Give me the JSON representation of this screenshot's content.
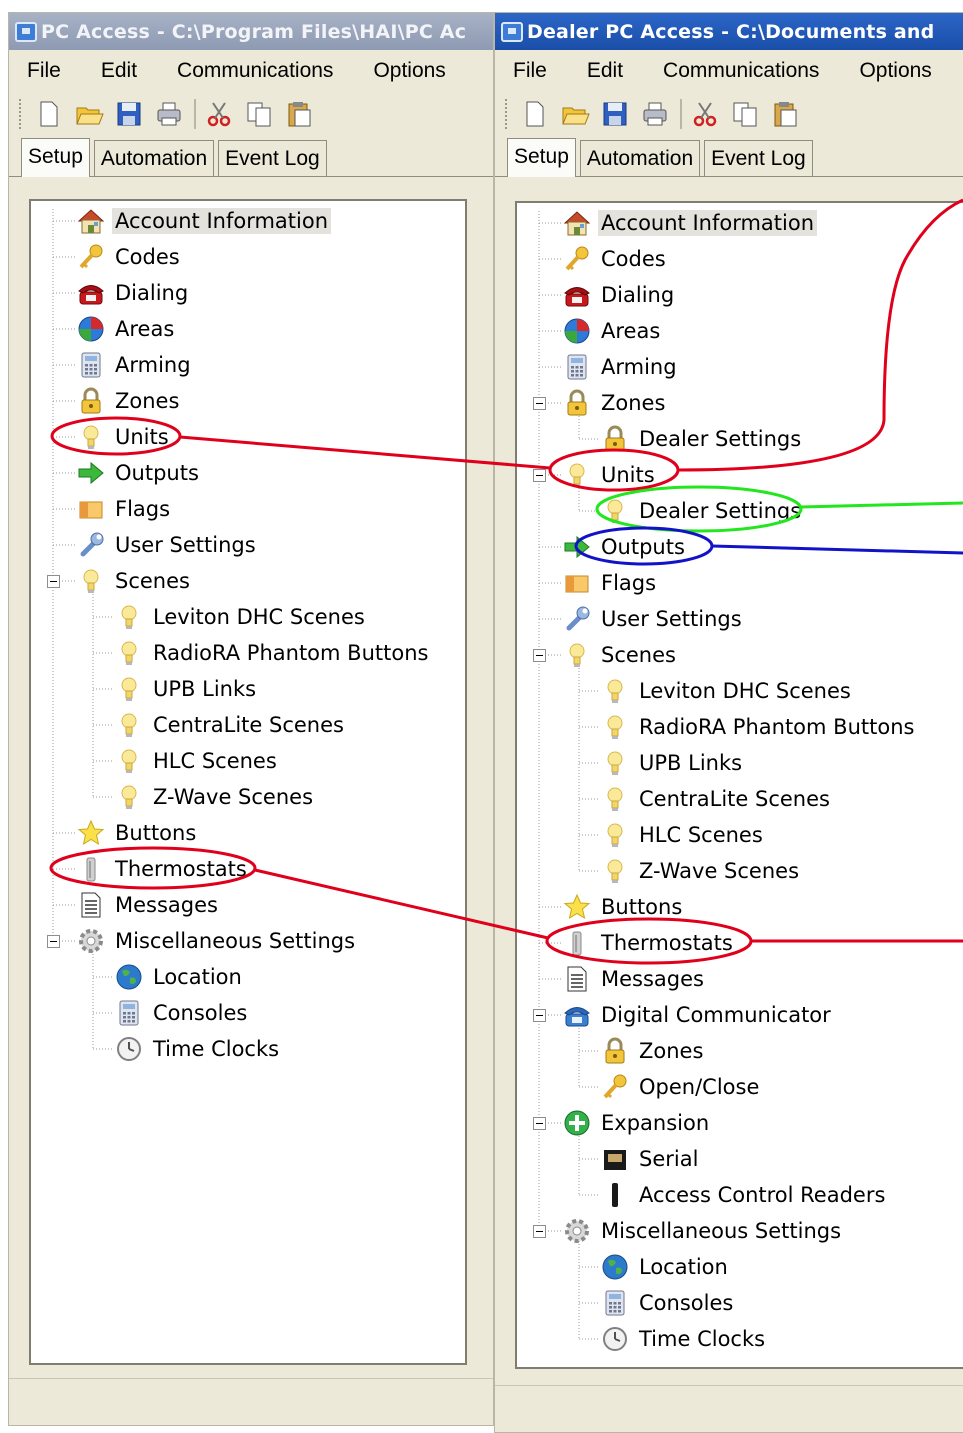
{
  "left_window": {
    "title": "PC Access - C:\\Program Files\\HAI\\PC Ac",
    "menu": [
      "File",
      "Edit",
      "Communications",
      "Options"
    ],
    "tabs": [
      "Setup",
      "Automation",
      "Event Log"
    ],
    "tree": [
      {
        "label": "Account Information",
        "icon": "house-icon",
        "level": 0,
        "selected": true
      },
      {
        "label": "Codes",
        "icon": "key-icon",
        "level": 0
      },
      {
        "label": "Dialing",
        "icon": "telephone-icon",
        "level": 0
      },
      {
        "label": "Areas",
        "icon": "globe-areas-icon",
        "level": 0
      },
      {
        "label": "Arming",
        "icon": "calculator-icon",
        "level": 0
      },
      {
        "label": "Zones",
        "icon": "padlock-icon",
        "level": 0
      },
      {
        "label": "Units",
        "icon": "lightbulb-icon",
        "level": 0
      },
      {
        "label": "Outputs",
        "icon": "green-arrow-icon",
        "level": 0
      },
      {
        "label": "Flags",
        "icon": "flag-icon",
        "level": 0
      },
      {
        "label": "User Settings",
        "icon": "wrench-icon",
        "level": 0
      },
      {
        "label": "Scenes",
        "icon": "lightbulb-icon",
        "level": 0,
        "expanded": true
      },
      {
        "label": "Leviton DHC Scenes",
        "icon": "lightbulb-icon",
        "level": 1
      },
      {
        "label": "RadioRA Phantom Buttons",
        "icon": "lightbulb-icon",
        "level": 1
      },
      {
        "label": "UPB Links",
        "icon": "lightbulb-icon",
        "level": 1
      },
      {
        "label": "CentraLite Scenes",
        "icon": "lightbulb-icon",
        "level": 1
      },
      {
        "label": "HLC Scenes",
        "icon": "lightbulb-icon",
        "level": 1
      },
      {
        "label": "Z-Wave Scenes",
        "icon": "lightbulb-icon",
        "level": 1
      },
      {
        "label": "Buttons",
        "icon": "star-icon",
        "level": 0
      },
      {
        "label": "Thermostats",
        "icon": "thermostat-icon",
        "level": 0
      },
      {
        "label": "Messages",
        "icon": "document-icon",
        "level": 0
      },
      {
        "label": "Miscellaneous Settings",
        "icon": "gear-icon",
        "level": 0,
        "expanded": true
      },
      {
        "label": "Location",
        "icon": "globe-icon",
        "level": 1
      },
      {
        "label": "Consoles",
        "icon": "console-icon",
        "level": 1
      },
      {
        "label": "Time Clocks",
        "icon": "clock-icon",
        "level": 1
      }
    ]
  },
  "right_window": {
    "title": "Dealer PC Access - C:\\Documents and",
    "menu": [
      "File",
      "Edit",
      "Communications",
      "Options"
    ],
    "tabs": [
      "Setup",
      "Automation",
      "Event Log"
    ],
    "tree": [
      {
        "label": "Account Information",
        "icon": "house-icon",
        "level": 0,
        "selected": true
      },
      {
        "label": "Codes",
        "icon": "key-icon",
        "level": 0
      },
      {
        "label": "Dialing",
        "icon": "telephone-icon",
        "level": 0
      },
      {
        "label": "Areas",
        "icon": "globe-areas-icon",
        "level": 0
      },
      {
        "label": "Arming",
        "icon": "calculator-icon",
        "level": 0
      },
      {
        "label": "Zones",
        "icon": "padlock-icon",
        "level": 0,
        "expanded": true
      },
      {
        "label": "Dealer Settings",
        "icon": "padlock-icon",
        "level": 1
      },
      {
        "label": "Units",
        "icon": "lightbulb-icon",
        "level": 0,
        "expanded": true
      },
      {
        "label": "Dealer Settings",
        "icon": "lightbulb-icon",
        "level": 1
      },
      {
        "label": "Outputs",
        "icon": "green-arrow-icon",
        "level": 0
      },
      {
        "label": "Flags",
        "icon": "flag-icon",
        "level": 0
      },
      {
        "label": "User Settings",
        "icon": "wrench-icon",
        "level": 0
      },
      {
        "label": "Scenes",
        "icon": "lightbulb-icon",
        "level": 0,
        "expanded": true
      },
      {
        "label": "Leviton DHC Scenes",
        "icon": "lightbulb-icon",
        "level": 1
      },
      {
        "label": "RadioRA Phantom Buttons",
        "icon": "lightbulb-icon",
        "level": 1
      },
      {
        "label": "UPB Links",
        "icon": "lightbulb-icon",
        "level": 1
      },
      {
        "label": "CentraLite Scenes",
        "icon": "lightbulb-icon",
        "level": 1
      },
      {
        "label": "HLC Scenes",
        "icon": "lightbulb-icon",
        "level": 1
      },
      {
        "label": "Z-Wave Scenes",
        "icon": "lightbulb-icon",
        "level": 1
      },
      {
        "label": "Buttons",
        "icon": "star-icon",
        "level": 0
      },
      {
        "label": "Thermostats",
        "icon": "thermostat-icon",
        "level": 0
      },
      {
        "label": "Messages",
        "icon": "document-icon",
        "level": 0
      },
      {
        "label": "Digital Communicator",
        "icon": "telephone-blue-icon",
        "level": 0,
        "expanded": true
      },
      {
        "label": "Zones",
        "icon": "padlock-icon",
        "level": 1
      },
      {
        "label": "Open/Close",
        "icon": "key-icon",
        "level": 1
      },
      {
        "label": "Expansion",
        "icon": "green-plus-icon",
        "level": 0,
        "expanded": true
      },
      {
        "label": "Serial",
        "icon": "serial-icon",
        "level": 1
      },
      {
        "label": "Access Control Readers",
        "icon": "reader-icon",
        "level": 1
      },
      {
        "label": "Miscellaneous Settings",
        "icon": "gear-icon",
        "level": 0,
        "expanded": true
      },
      {
        "label": "Location",
        "icon": "globe-icon",
        "level": 1
      },
      {
        "label": "Consoles",
        "icon": "console-icon",
        "level": 1
      },
      {
        "label": "Time Clocks",
        "icon": "clock-icon",
        "level": 1
      }
    ]
  },
  "annotations": {
    "colors": {
      "red": "#e0001b",
      "green": "#22e61e",
      "blue": "#1212c8"
    },
    "highlights": [
      {
        "window": "left",
        "item": "Units",
        "color": "red"
      },
      {
        "window": "left",
        "item": "Thermostats",
        "color": "red"
      },
      {
        "window": "right",
        "item": "Units",
        "color": "red"
      },
      {
        "window": "right",
        "item": "Dealer Settings",
        "color": "green"
      },
      {
        "window": "right",
        "item": "Outputs",
        "color": "blue"
      },
      {
        "window": "right",
        "item": "Thermostats",
        "color": "red"
      }
    ]
  }
}
